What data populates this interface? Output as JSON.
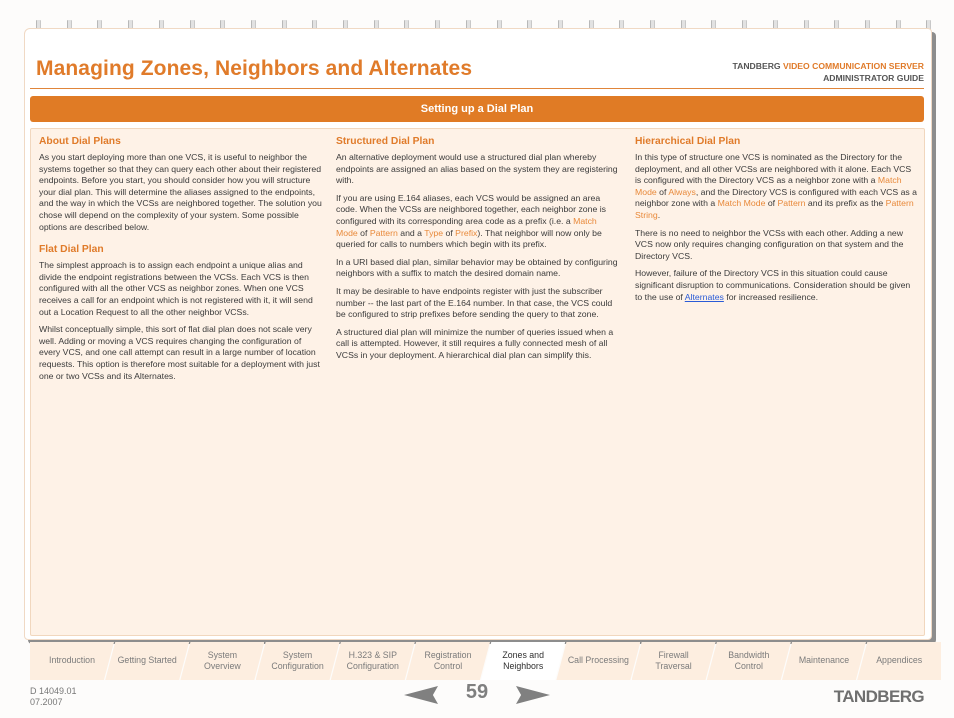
{
  "header": {
    "title": "Managing Zones, Neighbors and Alternates",
    "brand_line1_prefix": "TANDBERG",
    "brand_line1_accent": "VIDEO COMMUNICATION SERVER",
    "brand_line2": "ADMINISTRATOR GUIDE"
  },
  "section_title": "Setting up a Dial Plan",
  "colors": {
    "accent": "#e07b2a",
    "panel": "#fef2e7",
    "link": "#2a5bd7"
  },
  "columns": [
    {
      "heading": "About Dial Plans",
      "paragraphs": [
        "As you start deploying more than one VCS, it is useful to neighbor the systems together so that they can query each other about their registered endpoints. Before you start, you should consider how you will structure your dial plan.  This will determine the aliases assigned to the endpoints, and the way in which the VCSs are neighbored together.  The solution you chose will depend on the complexity of your system.  Some possible options are described below."
      ],
      "subheading": "Flat Dial Plan",
      "sub_paragraphs": [
        "The simplest approach is to assign each endpoint a unique alias and divide the endpoint registrations between the VCSs. Each VCS is then configured with all the other VCS as neighbor zones.  When one VCS receives a call for an endpoint which is not registered with it, it will send out a Location Request to all the other neighbor VCSs.",
        "Whilst conceptually simple, this sort of flat dial plan does not scale very well.  Adding or moving a VCS requires changing the configuration of every VCS, and one call attempt can result in a large number of location requests. This option is therefore most suitable for a deployment with just one or two VCSs and its Alternates."
      ]
    },
    {
      "heading": "Structured Dial Plan",
      "p1": "An alternative deployment would use a structured dial plan whereby endpoints are assigned an alias based on the system they are registering with.",
      "p2_a": "If you are using E.164 aliases, each VCS would be assigned an area code. When the VCSs are neighbored together, each neighbor zone is configured with its corresponding area code as a prefix (i.e. a ",
      "p2_kw1": "Match Mode",
      "p2_b": " of ",
      "p2_kw2": "Pattern",
      "p2_c": " and a ",
      "p2_kw3": "Type",
      "p2_d": " of ",
      "p2_kw4": "Prefix",
      "p2_e": "). That neighbor will now only be queried for calls to numbers which begin with its prefix.",
      "p3": "In a URI based dial plan, similar behavior may be obtained by configuring neighbors with a suffix to match the desired domain name.",
      "p4": "It may be desirable to have endpoints register with just the subscriber number -- the last part of the E.164 number. In that case, the VCS could be configured to strip prefixes before sending the query to that zone.",
      "p5": "A structured dial plan will minimize the number of queries issued when a call is attempted.  However, it still requires a fully connected mesh of all VCSs in your deployment. A hierarchical dial plan can simplify this."
    },
    {
      "heading": "Hierarchical Dial Plan",
      "p1_a": "In this type of structure one VCS is nominated as the Directory for the deployment, and all other VCSs are neighbored with it alone.  Each VCS is configured with the Directory VCS as a neighbor zone with a ",
      "p1_kw1": "Match Mode",
      "p1_b": " of ",
      "p1_kw2": "Always",
      "p1_c": ", and the Directory VCS is configured with each VCS as a neighbor zone with a ",
      "p1_kw3": "Match Mode",
      "p1_d": " of ",
      "p1_kw4": "Pattern",
      "p1_e": " and its prefix as the ",
      "p1_kw5": "Pattern String",
      "p1_f": ".",
      "p2": "There is no need to neighbor the VCSs with each other. Adding a new VCS now only requires changing configuration on that system and the Directory VCS.",
      "p3_a": "However, failure of the Directory VCS in this situation could cause significant disruption to communications. Consideration should be given to the use of ",
      "p3_link": "Alternates",
      "p3_b": " for increased resilience."
    }
  ],
  "tabs": [
    {
      "label": "Introduction",
      "active": false
    },
    {
      "label": "Getting Started",
      "active": false
    },
    {
      "label": "System Overview",
      "active": false
    },
    {
      "label": "System Configuration",
      "active": false
    },
    {
      "label": "H.323 & SIP Configuration",
      "active": false
    },
    {
      "label": "Registration Control",
      "active": false
    },
    {
      "label": "Zones and Neighbors",
      "active": true
    },
    {
      "label": "Call Processing",
      "active": false
    },
    {
      "label": "Firewall Traversal",
      "active": false
    },
    {
      "label": "Bandwidth Control",
      "active": false
    },
    {
      "label": "Maintenance",
      "active": false
    },
    {
      "label": "Appendices",
      "active": false
    }
  ],
  "footer": {
    "doc_number": "D 14049.01",
    "doc_date": "07.2007",
    "page_number": "59",
    "prev_icon": "arrow-left-icon",
    "next_icon": "arrow-right-icon",
    "logo": "TANDBERG"
  }
}
